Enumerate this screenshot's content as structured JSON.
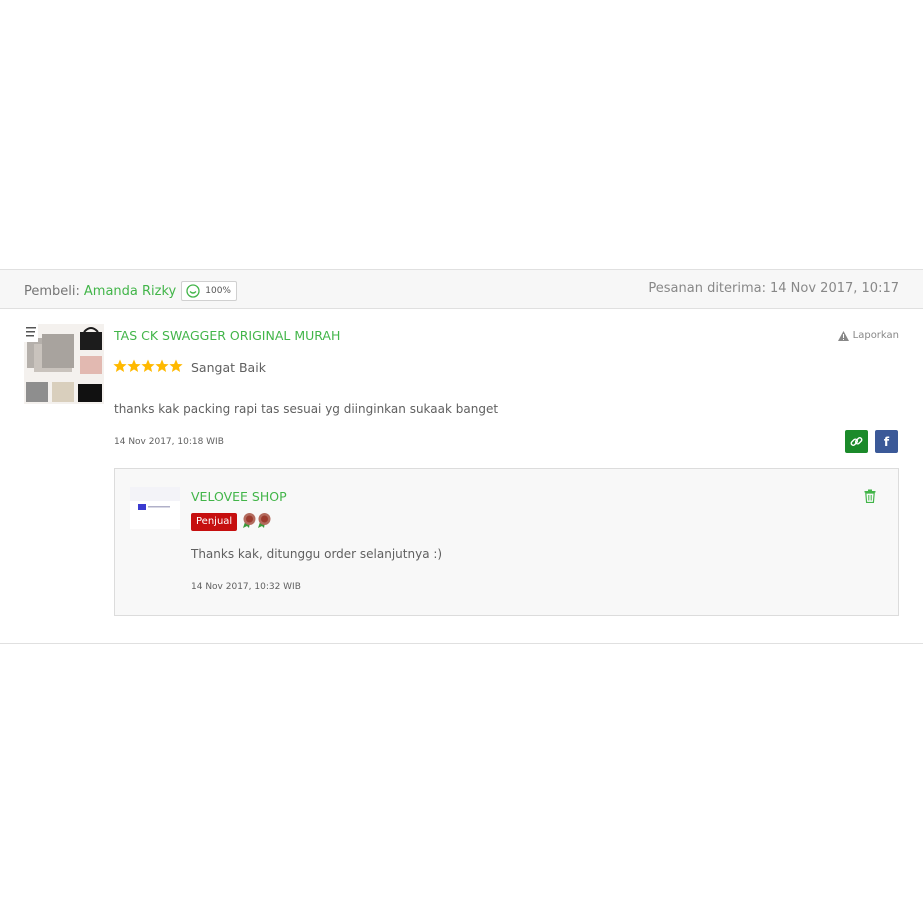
{
  "header": {
    "buyer_prefix": "Pembeli:",
    "buyer_name": "Amanda Rizky",
    "reputation": "100%",
    "order_label": "Pesanan diterima:",
    "order_date": "14 Nov 2017, 10:17"
  },
  "review": {
    "product_title": "TAS CK SWAGGER ORIGINAL MURAH",
    "report_label": "Laporkan",
    "rating_stars": 5,
    "rating_text": "Sangat Baik",
    "text": "thanks kak packing rapi tas sesuai yg diinginkan sukaak banget",
    "time": "14 Nov 2017, 10:18 WIB",
    "fb_label": "f"
  },
  "reply": {
    "shop_name": "VELOVEE SHOP",
    "badge": "Penjual",
    "text": "Thanks kak, ditunggu order selanjutnya :)",
    "time": "14 Nov 2017, 10:32 WIB"
  },
  "colors": {
    "accent_green": "#42b549",
    "seller_red": "#c60f0f",
    "facebook_blue": "#3b5998",
    "star_yellow": "#ffb900"
  },
  "icons": [
    "smile-reputation-icon",
    "warning-icon",
    "star-icon",
    "link-icon",
    "facebook-icon",
    "medal-icon",
    "trash-icon"
  ]
}
